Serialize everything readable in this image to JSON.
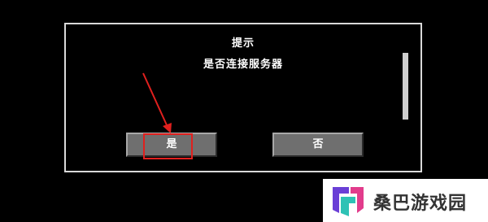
{
  "dialog": {
    "title": "提示",
    "message": "是否连接服务器",
    "confirm_label": "是",
    "cancel_label": "否"
  },
  "annotation": {
    "highlight_color": "#e0201e",
    "arrow_icon": "red-arrow-icon"
  },
  "watermark": {
    "text": "桑巴游戏园",
    "logo_icon": "sangba-logo-icon",
    "logo_colors": [
      "#6a3fd6",
      "#e23c8c",
      "#2ec2b5"
    ]
  },
  "colors": {
    "background": "#000000",
    "dialog_border": "#d9d9d9",
    "button_face": "#6f6f6f",
    "text": "#ffffff"
  }
}
